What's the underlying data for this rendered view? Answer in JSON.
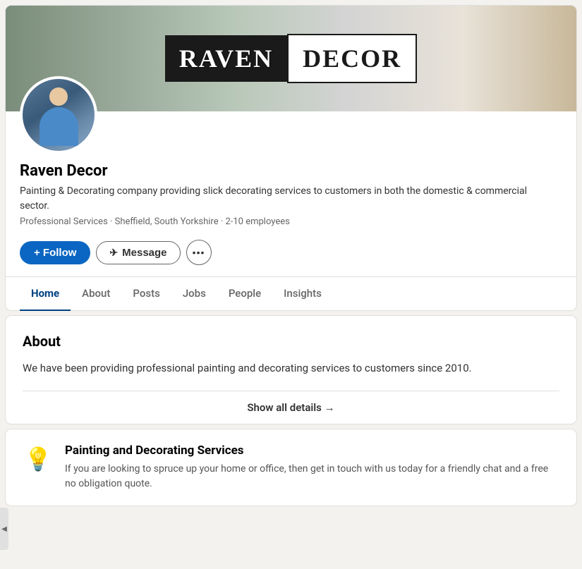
{
  "page": {
    "background": "#f3f2ef"
  },
  "banner": {
    "raven_text": "RAVEN",
    "decor_text": "DECOR"
  },
  "profile": {
    "company_name": "Raven Decor",
    "description": "Painting & Decorating company providing slick decorating services to customers in both the domestic & commercial sector.",
    "meta": "Professional Services · Sheffield, South Yorkshire · 2-10 employees"
  },
  "buttons": {
    "follow": "+ Follow",
    "message": "Message",
    "more_icon": "···"
  },
  "nav": {
    "tabs": [
      {
        "id": "home",
        "label": "Home",
        "active": true
      },
      {
        "id": "about",
        "label": "About",
        "active": false
      },
      {
        "id": "posts",
        "label": "Posts",
        "active": false
      },
      {
        "id": "jobs",
        "label": "Jobs",
        "active": false
      },
      {
        "id": "people",
        "label": "People",
        "active": false
      },
      {
        "id": "insights",
        "label": "Insights",
        "active": false
      }
    ]
  },
  "about_section": {
    "title": "About",
    "text": "We have been providing professional painting and decorating services to customers since 2010.",
    "show_all_label": "Show all details →"
  },
  "service_section": {
    "icon": "💡",
    "title": "Painting and Decorating Services",
    "description": "If you are looking to spruce up your home or office, then get in touch with us today for a friendly chat and a free no obligation quote."
  }
}
